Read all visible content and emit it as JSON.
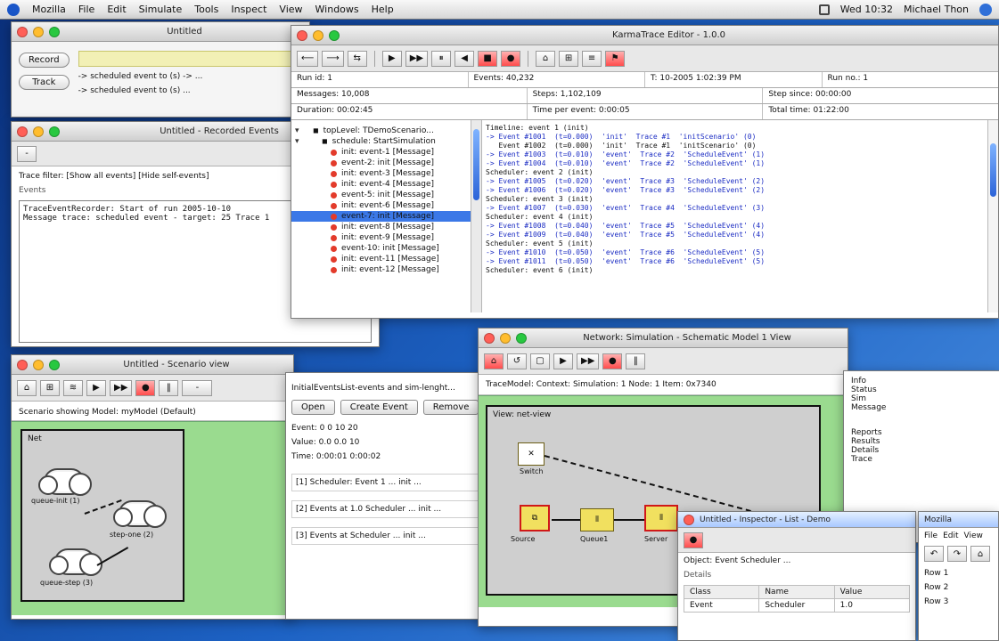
{
  "menubar": {
    "app": "Mozilla",
    "items": [
      "File",
      "Edit",
      "Simulate",
      "Tools",
      "Inspect",
      "View",
      "Windows",
      "Help"
    ],
    "right": {
      "status": "Wed 10:32",
      "user": "Michael Thon"
    }
  },
  "top_window": {
    "title": "KarmaTrace Editor - 1.0.0",
    "toolbar_labels": [
      "⟵",
      "⟶",
      "⇆",
      "▶",
      "▶▶",
      "⏸",
      "◀",
      "■",
      "●",
      "⌂",
      "⊞",
      "≡",
      "⚑"
    ],
    "fields": [
      [
        "Run id: 1",
        "Events: 40,232",
        "T: 10-2005 1:02:39 PM",
        "Run no.: 1"
      ],
      [
        "Messages: 10,008",
        "Steps: 1,102,109",
        "Step since: 00:00:00"
      ],
      [
        "Duration: 00:02:45",
        "Time per event: 0:00:05",
        "Total time: 01:22:00"
      ]
    ],
    "tree": [
      {
        "indent": 0,
        "text": "topLevel: TDemoScenario...",
        "bullet": false,
        "selected": false
      },
      {
        "indent": 1,
        "text": "schedule: StartSimulation",
        "bullet": false,
        "selected": false
      },
      {
        "indent": 2,
        "text": "init: event-1 [Message]",
        "bullet": true,
        "selected": false
      },
      {
        "indent": 2,
        "text": "event-2: init [Message]",
        "bullet": true,
        "selected": false
      },
      {
        "indent": 2,
        "text": "init: event-3 [Message]",
        "bullet": true,
        "selected": false
      },
      {
        "indent": 2,
        "text": "init: event-4 [Message]",
        "bullet": true,
        "selected": false
      },
      {
        "indent": 2,
        "text": "event-5: init [Message]",
        "bullet": true,
        "selected": false
      },
      {
        "indent": 2,
        "text": "init: event-6 [Message]",
        "bullet": true,
        "selected": false
      },
      {
        "indent": 2,
        "text": "event-7: init [Message]",
        "bullet": true,
        "selected": true
      },
      {
        "indent": 2,
        "text": "init: event-8 [Message]",
        "bullet": true,
        "selected": false
      },
      {
        "indent": 2,
        "text": "init: event-9 [Message]",
        "bullet": true,
        "selected": false
      },
      {
        "indent": 2,
        "text": "event-10: init [Message]",
        "bullet": true,
        "selected": false
      },
      {
        "indent": 2,
        "text": "init: event-11 [Message]",
        "bullet": true,
        "selected": false
      },
      {
        "indent": 2,
        "text": "init: event-12 [Message]",
        "bullet": true,
        "selected": false
      }
    ],
    "log_lines": [
      "Timeline: event 1 (init)",
      "-> Event #1001  (t=0.000)  'init'  Trace #1  'initScenario' (0)",
      "   Event #1002  (t=0.000)  'init'  Trace #1  'initScenario' (0)",
      "-> Event #1003  (t=0.010)  'event'  Trace #2  'ScheduleEvent' (1)",
      "-> Event #1004  (t=0.010)  'event'  Trace #2  'ScheduleEvent' (1)",
      "Scheduler: event 2 (init)",
      "-> Event #1005  (t=0.020)  'event'  Trace #3  'ScheduleEvent' (2)",
      "-> Event #1006  (t=0.020)  'event'  Trace #3  'ScheduleEvent' (2)",
      "Scheduler: event 3 (init)",
      "-> Event #1007  (t=0.030)  'event'  Trace #4  'ScheduleEvent' (3)",
      "Scheduler: event 4 (init)",
      "-> Event #1008  (t=0.040)  'event'  Trace #5  'ScheduleEvent' (4)",
      "-> Event #1009  (t=0.040)  'event'  Trace #5  'ScheduleEvent' (4)",
      "Scheduler: event 5 (init)",
      "-> Event #1010  (t=0.050)  'event'  Trace #6  'ScheduleEvent' (5)",
      "-> Event #1011  (t=0.050)  'event'  Trace #6  'ScheduleEvent' (5)",
      "Scheduler: event 6 (init)"
    ]
  },
  "left_windows": {
    "top_small": {
      "title": "Untitled",
      "buttons": [
        "Record",
        "Track"
      ],
      "line1": "-> scheduled event to (s) -> ...",
      "line2": "-> scheduled event to (s) ..."
    },
    "middle_large": {
      "title": "Untitled - Recorded Events",
      "toolbar_label": "-",
      "line_top": "Trace filter: [Show all events] [Hide self-events]",
      "line_sub": "Events",
      "lines": [
        "TraceEventRecorder: Start of run    2005-10-10",
        "Message trace: scheduled event - target: 25 Trace 1"
      ]
    },
    "bottom_left": {
      "title": "Untitled - Scenario view",
      "toolbar_hint": "-",
      "line": "Scenario showing Model: myModel (Default)",
      "box_title": "Net",
      "cloud_labels": [
        "queue-init (1)",
        "step-one (2)",
        "queue-step (3)"
      ]
    }
  },
  "center_windows": {
    "middle_text": {
      "line_header": "InitialEventsList-events and sim-lenght...",
      "buttons": [
        "Open",
        "Create Event",
        "Remove"
      ],
      "fields": [
        "Event: 0 0 10 20",
        "Value: 0.0 0.0 10",
        "Time: 0:00:01 0:00:02"
      ],
      "list_items": [
        "[1] Scheduler: Event 1 ... init ...",
        "[2] Events at 1.0 Scheduler ... init ...",
        "[3] Events at Scheduler ... init ..."
      ]
    },
    "graph_window": {
      "title": "Network: Simulation - Schematic Model 1 View",
      "toolbar_labels": [
        "⌂",
        "↺",
        "▢",
        "▶",
        "▶▶",
        "●",
        "‖"
      ],
      "label": "TraceModel: Context: Simulation: 1 Node: 1 Item: 0x7340",
      "subtitle": "View: net-view",
      "nodes": [
        {
          "label": "Source",
          "style": "red"
        },
        {
          "label": "Queue1",
          "style": "thin"
        },
        {
          "label": "Server",
          "style": "red"
        }
      ],
      "top_node_label": "Switch"
    }
  },
  "bottom_right": {
    "window_a": {
      "title": "Untitled - Inspector - List - Demo",
      "row1": "Object: Event Scheduler ...",
      "row2": "Details",
      "table_headers": [
        "Class",
        "Name",
        "Value"
      ],
      "table_rows": [
        [
          "Event",
          "Scheduler",
          "1.0"
        ]
      ]
    },
    "window_b": {
      "title": "Mozilla",
      "menu": [
        "File",
        "Edit",
        "View"
      ],
      "rows": [
        "Row 1",
        "Row 2",
        "Row 3"
      ]
    }
  },
  "right_edge_text": {
    "lines": [
      "Info",
      "Status",
      "Sim",
      "Message",
      "Reports",
      "Results",
      "Details",
      "Trace"
    ]
  }
}
